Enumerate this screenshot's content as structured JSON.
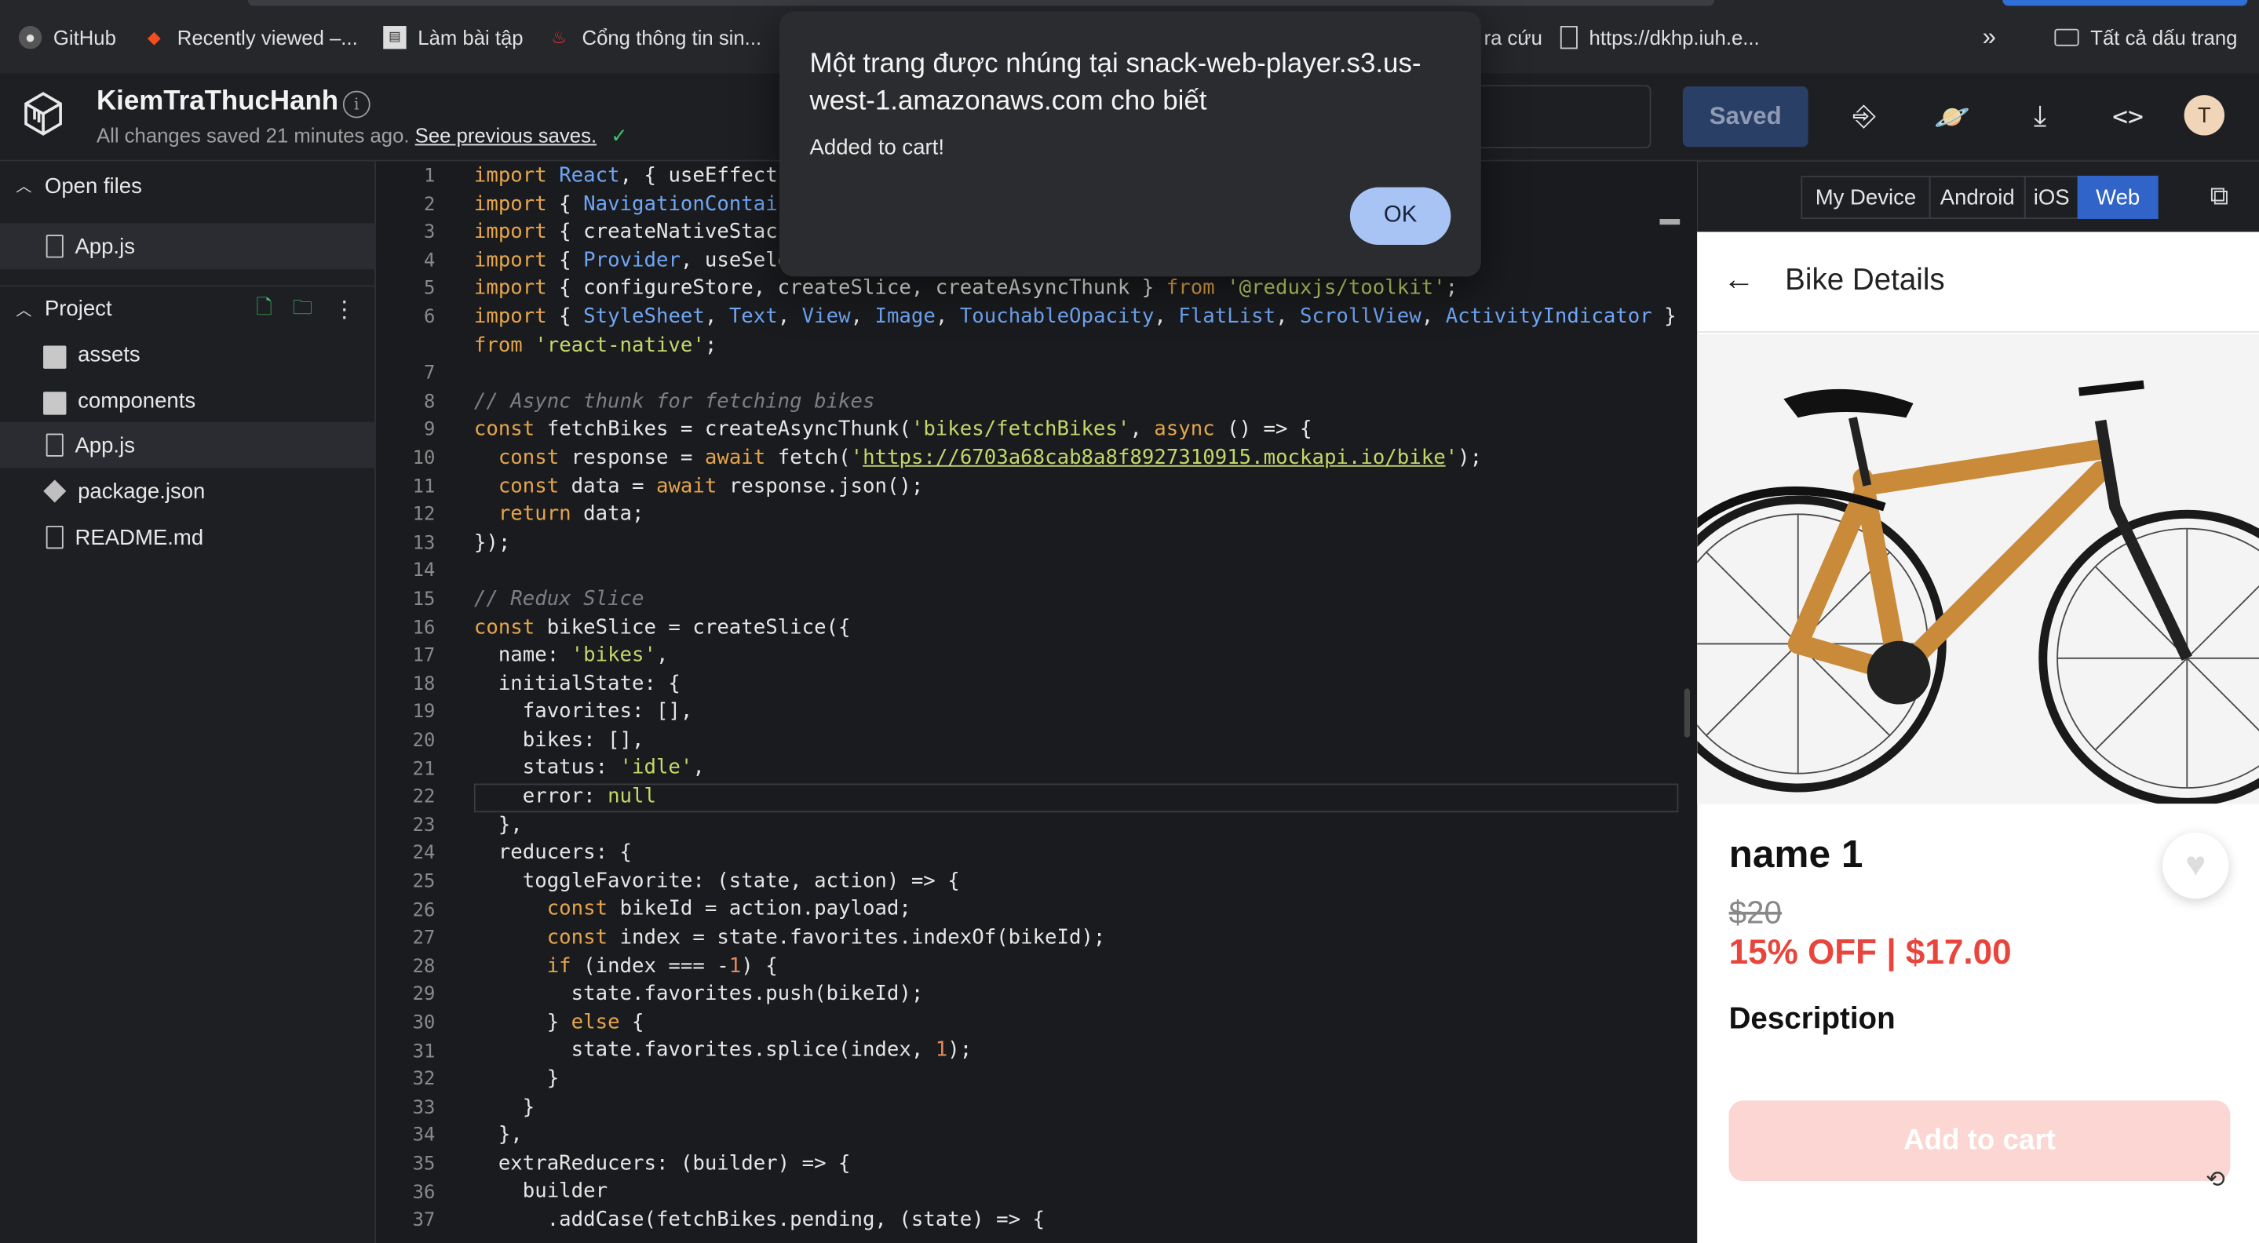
{
  "bookmarks": {
    "items": [
      "GitHub",
      "Recently viewed –...",
      "Làm bài tập",
      "Cổng thông tin sin...",
      "ra cứu",
      "https://dkhp.iuh.e..."
    ],
    "more": "»",
    "all_bookmarks": "Tất cả dấu trang"
  },
  "header": {
    "project_title": "KiemTraThucHanh",
    "info": "i",
    "status_text": "All changes saved 21 minutes ago.",
    "previous_saves_link": "See previous saves.",
    "check": "✓",
    "saved_button": "Saved",
    "avatar_letter": "T"
  },
  "sidebar": {
    "open_files_label": "Open files",
    "open_files": [
      "App.js"
    ],
    "project_label": "Project",
    "project_items": [
      {
        "label": "assets",
        "type": "folder"
      },
      {
        "label": "components",
        "type": "folder"
      },
      {
        "label": "App.js",
        "type": "file"
      },
      {
        "label": "package.json",
        "type": "package"
      },
      {
        "label": "README.md",
        "type": "file"
      }
    ]
  },
  "editor": {
    "line_numbers": [
      "1",
      "2",
      "3",
      "4",
      "5",
      "6",
      "",
      "7",
      "8",
      "9",
      "10",
      "11",
      "12",
      "13",
      "14",
      "15",
      "16",
      "17",
      "18",
      "19",
      "20",
      "21",
      "22",
      "23",
      "24",
      "25",
      "26",
      "27",
      "28",
      "29",
      "30",
      "31",
      "32",
      "33",
      "34",
      "35",
      "36",
      "37"
    ]
  },
  "preview": {
    "tabs": [
      "My Device",
      "Android",
      "iOS",
      "Web"
    ],
    "active_tab": "Web",
    "screen_title": "Bike Details",
    "product_name": "name 1",
    "original_price": "$20",
    "discount_price": "15% OFF | $17.00",
    "description_label": "Description",
    "add_to_cart": "Add to cart"
  },
  "dialog": {
    "title": "Một trang được nhúng tại snack-web-player.s3.us-west-1.amazonaws.com cho biết",
    "message": "Added to cart!",
    "ok": "OK"
  },
  "colors": {
    "accent": "#3064c8",
    "price_red": "#e8453c",
    "ok_button": "#a8c4f4"
  }
}
